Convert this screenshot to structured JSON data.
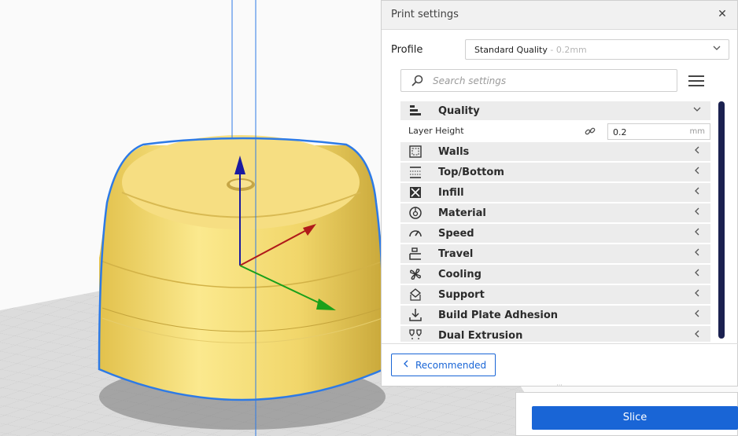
{
  "panel": {
    "title": "Print settings",
    "close_icon": "close-icon",
    "profile_label": "Profile",
    "profile_value": "Standard Quality",
    "profile_sub": " - 0.2mm",
    "search_placeholder": "Search settings",
    "categories": [
      {
        "label": "Quality",
        "icon": "quality-icon",
        "expanded": true
      },
      {
        "label": "Walls",
        "icon": "walls-icon"
      },
      {
        "label": "Top/Bottom",
        "icon": "top-bottom-icon"
      },
      {
        "label": "Infill",
        "icon": "infill-icon"
      },
      {
        "label": "Material",
        "icon": "material-icon"
      },
      {
        "label": "Speed",
        "icon": "speed-icon"
      },
      {
        "label": "Travel",
        "icon": "travel-icon"
      },
      {
        "label": "Cooling",
        "icon": "cooling-icon"
      },
      {
        "label": "Support",
        "icon": "support-icon"
      },
      {
        "label": "Build Plate Adhesion",
        "icon": "build-plate-adhesion-icon"
      },
      {
        "label": "Dual Extrusion",
        "icon": "dual-extrusion-icon"
      }
    ],
    "layer_height": {
      "label": "Layer Height",
      "value": "0.2",
      "unit": "mm"
    },
    "recommended_label": "Recommended"
  },
  "slice_label": "Slice",
  "colors": {
    "accent": "#1965d6",
    "model": "#f5dc75",
    "scroll_thumb": "#1b2150"
  }
}
